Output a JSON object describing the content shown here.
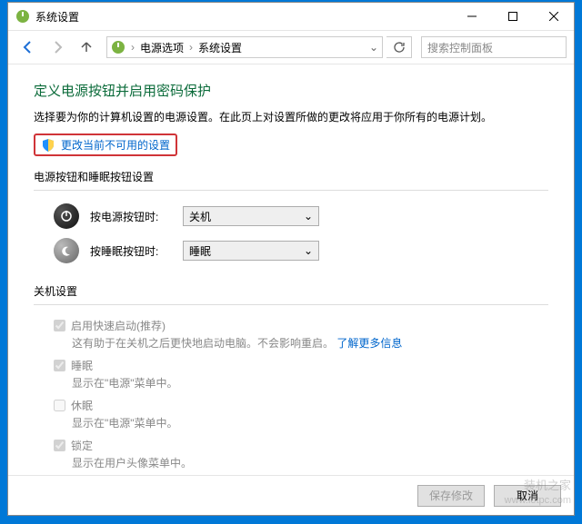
{
  "window": {
    "title": "系统设置"
  },
  "nav": {
    "breadcrumb": [
      "电源选项",
      "系统设置"
    ],
    "search_placeholder": "搜索控制面板"
  },
  "page": {
    "heading": "定义电源按钮并启用密码保护",
    "description": "选择要为你的计算机设置的电源设置。在此页上对设置所做的更改将应用于你所有的电源计划。",
    "change_link": "更改当前不可用的设置"
  },
  "buttons_section": {
    "title": "电源按钮和睡眠按钮设置",
    "power_label": "按电源按钮时:",
    "power_value": "关机",
    "sleep_label": "按睡眠按钮时:",
    "sleep_value": "睡眠"
  },
  "shutdown_section": {
    "title": "关机设置",
    "items": [
      {
        "label": "启用快速启动(推荐)",
        "checked": true,
        "sub": "这有助于在关机之后更快地启动电脑。不会影响重启。",
        "link": "了解更多信息"
      },
      {
        "label": "睡眠",
        "checked": true,
        "sub": "显示在\"电源\"菜单中。"
      },
      {
        "label": "休眠",
        "checked": false,
        "sub": "显示在\"电源\"菜单中。"
      },
      {
        "label": "锁定",
        "checked": true,
        "sub": "显示在用户头像菜单中。"
      }
    ]
  },
  "footer": {
    "save": "保存修改",
    "cancel": "取消"
  },
  "watermark": {
    "line1": "装机之家",
    "line2": "www.lotpc.com"
  }
}
